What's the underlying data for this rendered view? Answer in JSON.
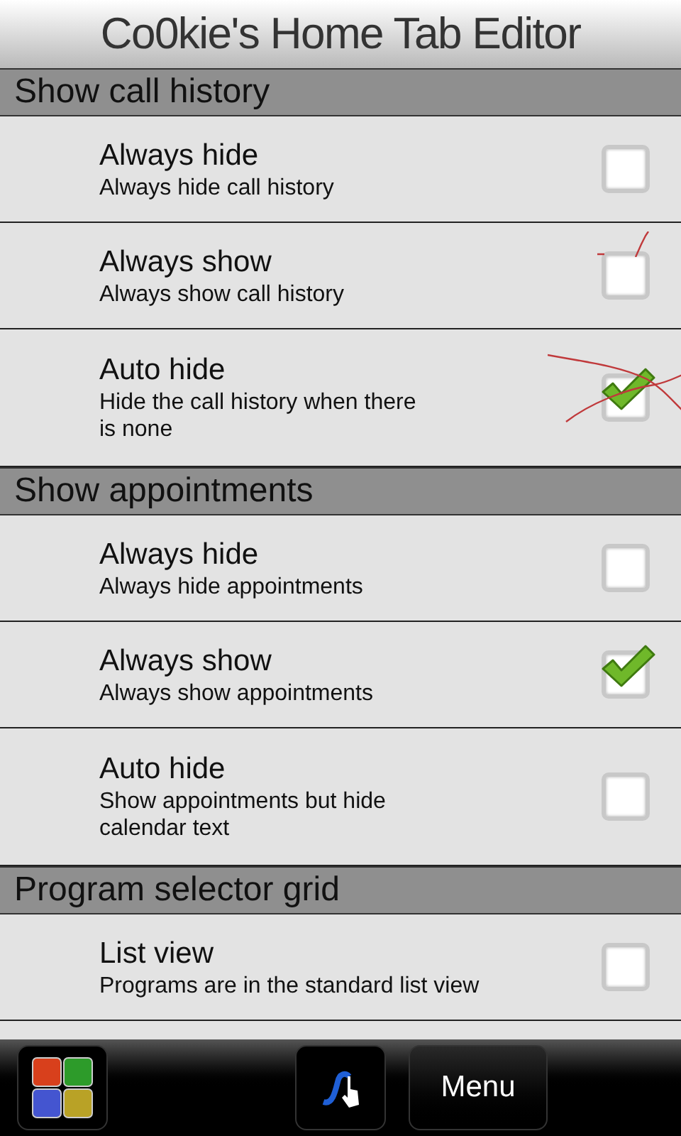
{
  "title": "Co0kie's Home Tab Editor",
  "sections": [
    {
      "heading": "Show call history",
      "options": [
        {
          "label": "Always hide",
          "description": "Always hide call history",
          "checked": false,
          "scribbled": false
        },
        {
          "label": "Always show",
          "description": "Always show call history",
          "checked": false,
          "scribbled": true
        },
        {
          "label": "Auto hide",
          "description": "Hide the call history when there is none",
          "checked": true,
          "scribbled": true
        }
      ]
    },
    {
      "heading": "Show appointments",
      "options": [
        {
          "label": "Always hide",
          "description": "Always hide appointments",
          "checked": false,
          "scribbled": false
        },
        {
          "label": "Always show",
          "description": "Always show appointments",
          "checked": true,
          "scribbled": false
        },
        {
          "label": "Auto hide",
          "description": "Show appointments but hide calendar text",
          "checked": false,
          "scribbled": false
        }
      ]
    },
    {
      "heading": "Program selector grid",
      "options": [
        {
          "label": "List view",
          "description": "Programs are in the standard list view",
          "checked": false,
          "scribbled": false
        }
      ]
    }
  ],
  "menu_button": "Menu"
}
